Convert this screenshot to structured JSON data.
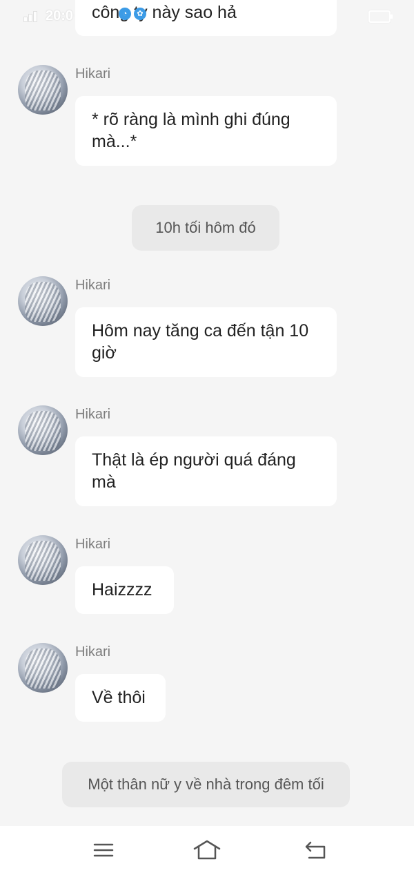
{
  "status_bar": {
    "time": "20:0",
    "icons": [
      "signal-icon",
      "wifi-icon",
      "battery-icon"
    ]
  },
  "messages": [
    {
      "type": "partial",
      "text": "công ty này sao hả"
    },
    {
      "type": "message",
      "sender": "Hikari",
      "text": "* rõ ràng là mình ghi đúng mà...*"
    },
    {
      "type": "narration",
      "text": "10h tối hôm đó"
    },
    {
      "type": "message",
      "sender": "Hikari",
      "text": "Hôm nay tăng ca đến tận 10 giờ"
    },
    {
      "type": "message",
      "sender": "Hikari",
      "text": "Thật là ép người quá đáng mà"
    },
    {
      "type": "message",
      "sender": "Hikari",
      "text": "Haizzzz"
    },
    {
      "type": "message",
      "sender": "Hikari",
      "text": "Về thôi"
    },
    {
      "type": "narration",
      "text": "Một thân nữ y về nhà trong đêm tối"
    }
  ],
  "nav": {
    "icons": [
      "menu-icon",
      "home-icon",
      "back-icon"
    ]
  }
}
